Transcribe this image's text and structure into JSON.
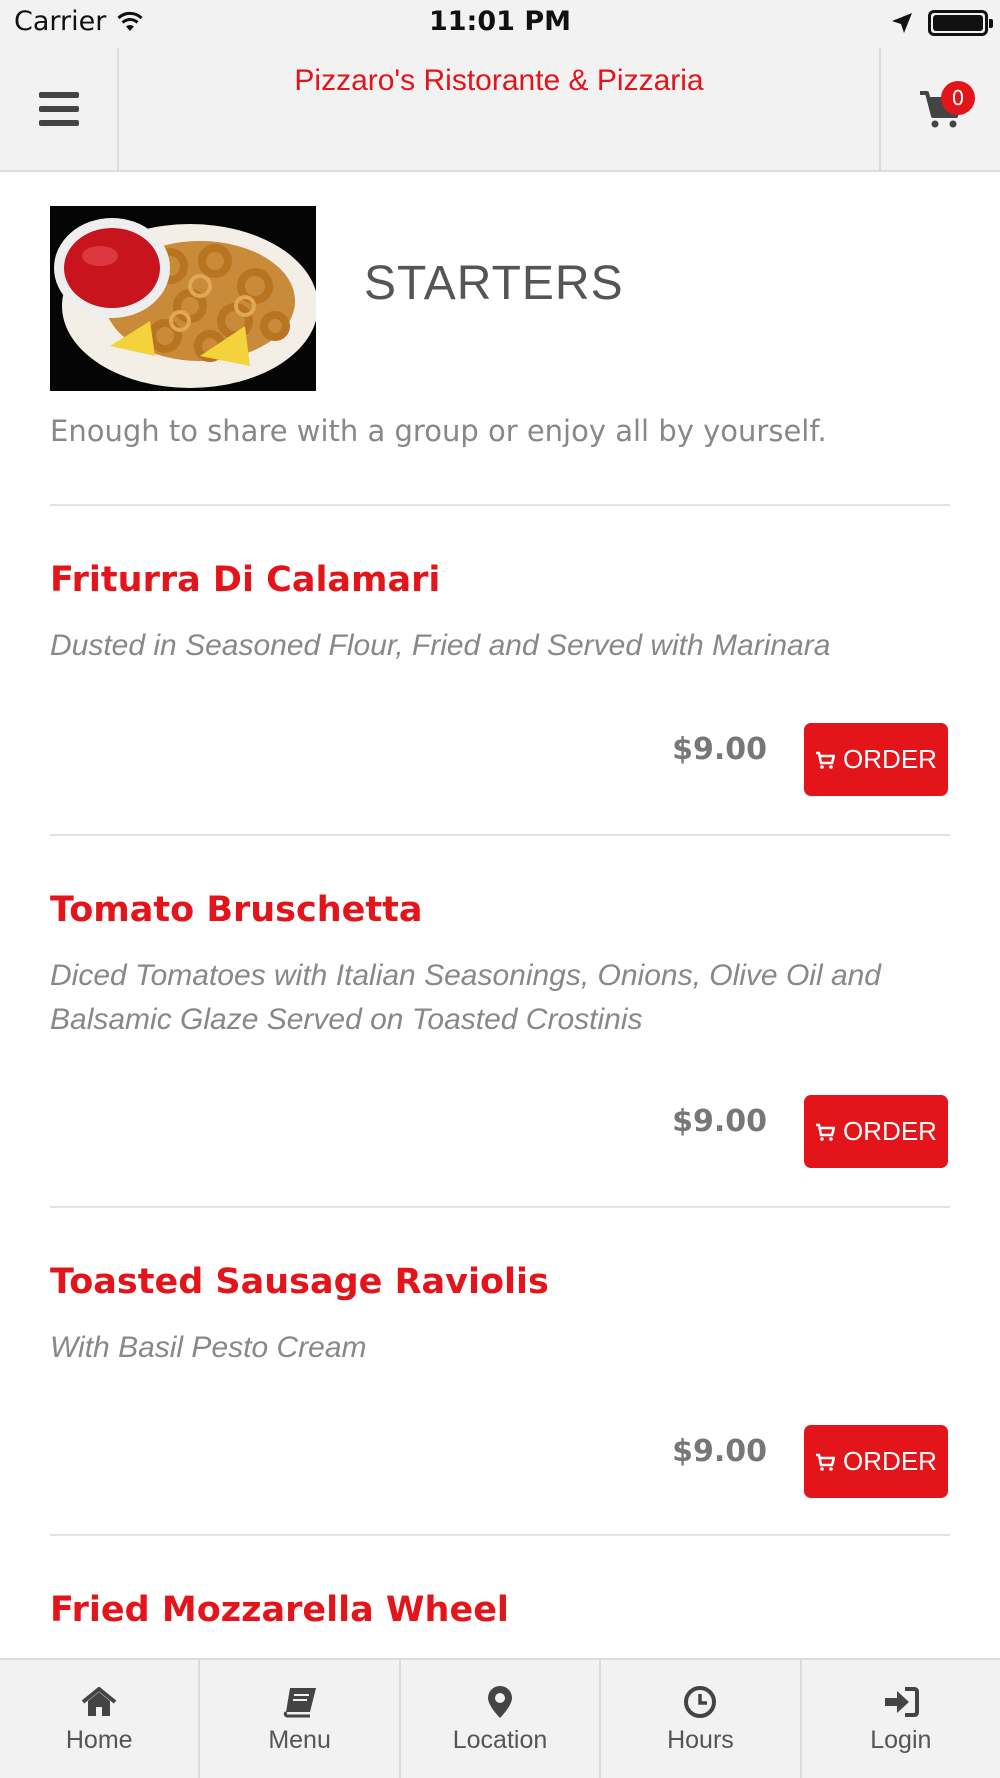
{
  "status_bar": {
    "carrier": "Carrier",
    "time": "11:01 PM"
  },
  "header": {
    "title": "Pizzaro's Ristorante & Pizzaria",
    "cart_count": "0",
    "menu_icon": "hamburger-menu-icon",
    "cart_icon": "shopping-cart-icon"
  },
  "category": {
    "title": "STARTERS",
    "description": "Enough to share with a group or enjoy all by yourself.",
    "image": "fried calamari with marinara sauce and lemon"
  },
  "items": [
    {
      "name": "Friturra Di Calamari",
      "description": "Dusted in Seasoned Flour, Fried and Served with Marinara",
      "price": "$9.00",
      "order_label": "ORDER"
    },
    {
      "name": "Tomato Bruschetta",
      "description": "Diced Tomatoes with Italian Seasonings, Onions, Olive Oil and Balsamic Glaze Served on Toasted Crostinis",
      "price": "$9.00",
      "order_label": "ORDER"
    },
    {
      "name": "Toasted Sausage Raviolis",
      "description": "With Basil Pesto Cream",
      "price": "$9.00",
      "order_label": "ORDER"
    },
    {
      "name": "Fried Mozzarella Wheel"
    }
  ],
  "tabs": [
    {
      "label": "Home",
      "icon": "home-icon"
    },
    {
      "label": "Menu",
      "icon": "book-icon"
    },
    {
      "label": "Location",
      "icon": "map-pin-icon"
    },
    {
      "label": "Hours",
      "icon": "clock-icon"
    },
    {
      "label": "Login",
      "icon": "sign-in-icon"
    }
  ],
  "colors": {
    "accent": "#e3141a",
    "bar_background": "#f2f2f2",
    "muted_text": "#888888"
  }
}
